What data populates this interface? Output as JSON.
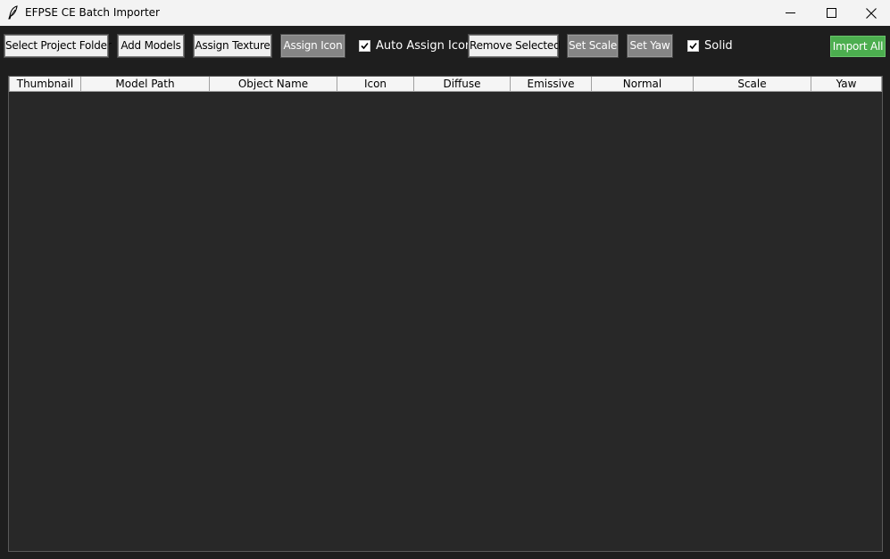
{
  "window": {
    "title": "EFPSE CE Batch Importer"
  },
  "toolbar": {
    "select_project_folder": "Select Project Folder",
    "add_models": "Add Models",
    "assign_texture": "Assign Texture",
    "assign_icon": "Assign Icon",
    "auto_assign_icon": {
      "label": "Auto Assign Icon",
      "checked": true
    },
    "remove_selected": "Remove Selected",
    "set_scale": "Set Scale",
    "set_yaw": "Set Yaw",
    "solid": {
      "label": "Solid",
      "checked": true
    },
    "import_all": "Import All"
  },
  "table": {
    "columns": [
      "Thumbnail",
      "Model Path",
      "Object Name",
      "Icon",
      "Diffuse",
      "Emissive",
      "Normal",
      "Scale",
      "Yaw"
    ],
    "rows": []
  },
  "colors": {
    "background": "#1e1e1e",
    "table_background": "#282828",
    "import_button": "#4cae4f",
    "gray_button": "#858585"
  }
}
